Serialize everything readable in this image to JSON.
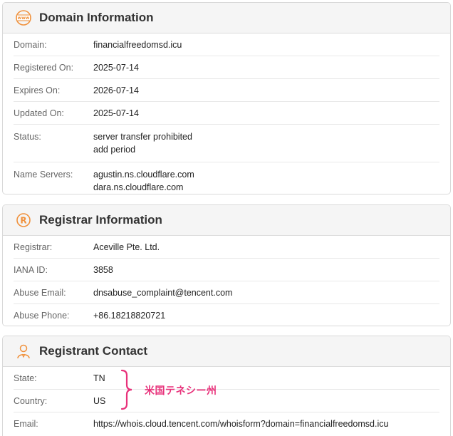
{
  "domain_info": {
    "title": "Domain Information",
    "rows": [
      {
        "label": "Domain:",
        "value": "financialfreedomsd.icu"
      },
      {
        "label": "Registered On:",
        "value": "2025-07-14"
      },
      {
        "label": "Expires On:",
        "value": "2026-07-14"
      },
      {
        "label": "Updated On:",
        "value": "2025-07-14"
      }
    ],
    "status_label": "Status:",
    "status_values": [
      "server transfer prohibited",
      "add period"
    ],
    "ns_label": "Name Servers:",
    "ns_values": [
      "agustin.ns.cloudflare.com",
      "dara.ns.cloudflare.com"
    ],
    "icon": "www-globe-icon"
  },
  "registrar_info": {
    "title": "Registrar Information",
    "rows": [
      {
        "label": "Registrar:",
        "value": "Aceville Pte. Ltd."
      },
      {
        "label": "IANA ID:",
        "value": "3858"
      },
      {
        "label": "Abuse Email:",
        "value": "dnsabuse_complaint@tencent.com"
      },
      {
        "label": "Abuse Phone:",
        "value": "+86.18218820721"
      }
    ],
    "icon": "registered-mark-icon"
  },
  "registrant_contact": {
    "title": "Registrant Contact",
    "rows": [
      {
        "label": "State:",
        "value": "TN"
      },
      {
        "label": "Country:",
        "value": "US"
      },
      {
        "label": "Email:",
        "value": "https://whois.cloud.tencent.com/whoisform?domain=financialfreedomsd.icu"
      }
    ],
    "icon": "person-icon"
  },
  "annotation": {
    "text": "米国テネシー州",
    "color": "#e8327b"
  },
  "colors": {
    "accent_icon": "#f0913c",
    "header_bg": "#f5f5f5"
  }
}
